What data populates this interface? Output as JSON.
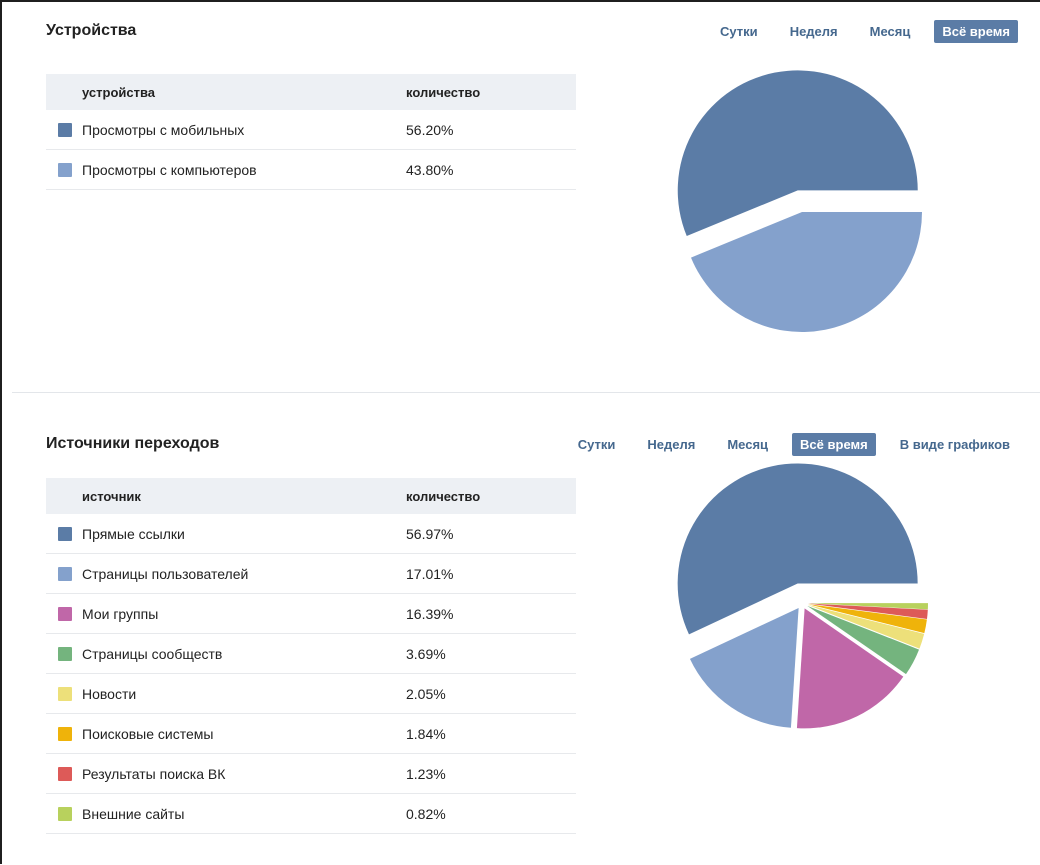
{
  "devices": {
    "title": "Устройства",
    "periods": [
      "Сутки",
      "Неделя",
      "Месяц",
      "Всё время"
    ],
    "active_period": 3,
    "col_name": "устройства",
    "col_value": "количество"
  },
  "sources": {
    "title": "Источники переходов",
    "periods": [
      "Сутки",
      "Неделя",
      "Месяц",
      "Всё время",
      "В виде графиков"
    ],
    "active_period": 3,
    "col_name": "источник",
    "col_value": "количество"
  },
  "chart_data": [
    {
      "type": "pie",
      "categories": [
        "Просмотры с мобильных",
        "Просмотры с компьютеров"
      ],
      "values": [
        56.2,
        43.8
      ],
      "labels": [
        "56.20%",
        "43.80%"
      ],
      "colors": [
        "#5b7ca6",
        "#84a1cc"
      ],
      "explode_index": 0
    },
    {
      "type": "pie",
      "categories": [
        "Прямые ссылки",
        "Страницы пользователей",
        "Мои группы",
        "Страницы сообществ",
        "Новости",
        "Поисковые системы",
        "Результаты поиска ВК",
        "Внешние сайты"
      ],
      "values": [
        56.97,
        17.01,
        16.39,
        3.69,
        2.05,
        1.84,
        1.23,
        0.82
      ],
      "labels": [
        "56.97%",
        "17.01%",
        "16.39%",
        "3.69%",
        "2.05%",
        "1.84%",
        "1.23%",
        "0.82%"
      ],
      "colors": [
        "#5b7ca6",
        "#84a1cc",
        "#c067a8",
        "#74b47e",
        "#ede07a",
        "#efb30a",
        "#dd5a58",
        "#b8d15d"
      ],
      "explode_index": 0
    }
  ]
}
